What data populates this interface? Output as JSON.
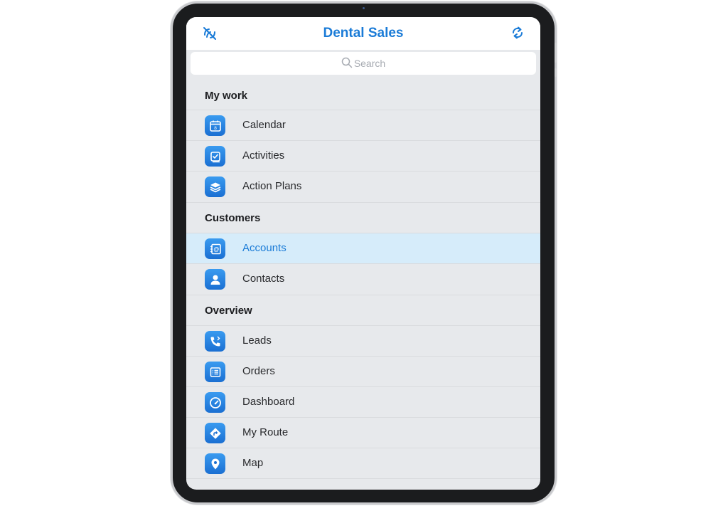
{
  "colors": {
    "accent": "#1a7bd7",
    "selected_row": "#d6ecfa",
    "background": "#e7e9ec"
  },
  "navbar": {
    "title": "Dental Sales",
    "left_icon": "offline-sync-icon",
    "right_icon": "refresh-icon"
  },
  "search": {
    "placeholder": "Search"
  },
  "sections": [
    {
      "header": "My work",
      "items": [
        {
          "label": "Calendar",
          "icon": "calendar-icon"
        },
        {
          "label": "Activities",
          "icon": "activities-icon"
        },
        {
          "label": "Action Plans",
          "icon": "layers-icon"
        }
      ]
    },
    {
      "header": "Customers",
      "items": [
        {
          "label": "Accounts",
          "icon": "accounts-icon",
          "selected": true
        },
        {
          "label": "Contacts",
          "icon": "person-icon"
        }
      ]
    },
    {
      "header": "Overview",
      "items": [
        {
          "label": "Leads",
          "icon": "phone-icon"
        },
        {
          "label": "Orders",
          "icon": "orders-icon"
        },
        {
          "label": "Dashboard",
          "icon": "gauge-icon"
        },
        {
          "label": "My Route",
          "icon": "route-icon"
        },
        {
          "label": "Map",
          "icon": "map-pin-icon"
        }
      ]
    }
  ]
}
